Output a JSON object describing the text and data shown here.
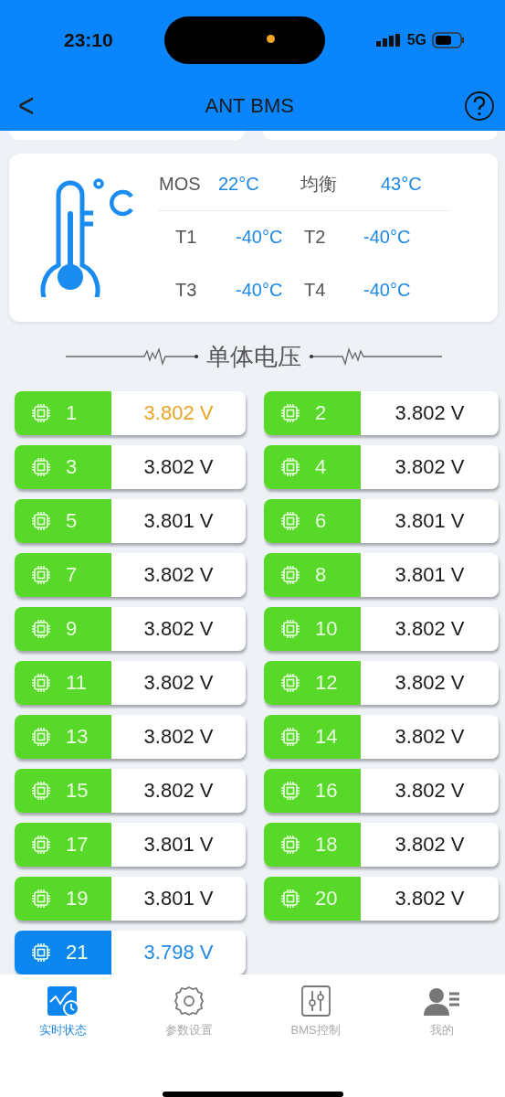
{
  "status_bar": {
    "time": "23:10",
    "network": "5G"
  },
  "header": {
    "back": "<",
    "title": "ANT BMS"
  },
  "temperature": {
    "rows": [
      {
        "items": [
          {
            "label": "MOS",
            "value": "22°C"
          },
          {
            "label": "均衡",
            "value": "43°C"
          }
        ]
      },
      {
        "items": [
          {
            "label": "T1",
            "value": "-40°C"
          },
          {
            "label": "T2",
            "value": "-40°C"
          }
        ]
      },
      {
        "items": [
          {
            "label": "T3",
            "value": "-40°C"
          },
          {
            "label": "T4",
            "value": "-40°C"
          }
        ]
      }
    ]
  },
  "section_title": "单体电压",
  "cells": [
    {
      "index": "1",
      "voltage": "3.802 V",
      "kind": "max"
    },
    {
      "index": "2",
      "voltage": "3.802 V",
      "kind": "normal"
    },
    {
      "index": "3",
      "voltage": "3.802 V",
      "kind": "normal"
    },
    {
      "index": "4",
      "voltage": "3.802 V",
      "kind": "normal"
    },
    {
      "index": "5",
      "voltage": "3.801 V",
      "kind": "normal"
    },
    {
      "index": "6",
      "voltage": "3.801 V",
      "kind": "normal"
    },
    {
      "index": "7",
      "voltage": "3.802 V",
      "kind": "normal"
    },
    {
      "index": "8",
      "voltage": "3.801 V",
      "kind": "normal"
    },
    {
      "index": "9",
      "voltage": "3.802 V",
      "kind": "normal"
    },
    {
      "index": "10",
      "voltage": "3.802 V",
      "kind": "normal"
    },
    {
      "index": "11",
      "voltage": "3.802 V",
      "kind": "normal"
    },
    {
      "index": "12",
      "voltage": "3.802 V",
      "kind": "normal"
    },
    {
      "index": "13",
      "voltage": "3.802 V",
      "kind": "normal"
    },
    {
      "index": "14",
      "voltage": "3.802 V",
      "kind": "normal"
    },
    {
      "index": "15",
      "voltage": "3.802 V",
      "kind": "normal"
    },
    {
      "index": "16",
      "voltage": "3.802 V",
      "kind": "normal"
    },
    {
      "index": "17",
      "voltage": "3.801 V",
      "kind": "normal"
    },
    {
      "index": "18",
      "voltage": "3.802 V",
      "kind": "normal"
    },
    {
      "index": "19",
      "voltage": "3.801 V",
      "kind": "normal"
    },
    {
      "index": "20",
      "voltage": "3.802 V",
      "kind": "normal"
    },
    {
      "index": "21",
      "voltage": "3.798 V",
      "kind": "min"
    }
  ],
  "tabs": [
    {
      "label": "实时状态",
      "kind": "realtime",
      "selected": true
    },
    {
      "label": "参数设置",
      "kind": "settings",
      "selected": false
    },
    {
      "label": "BMS控制",
      "kind": "control",
      "selected": false
    },
    {
      "label": "我的",
      "kind": "profile",
      "selected": false
    }
  ]
}
